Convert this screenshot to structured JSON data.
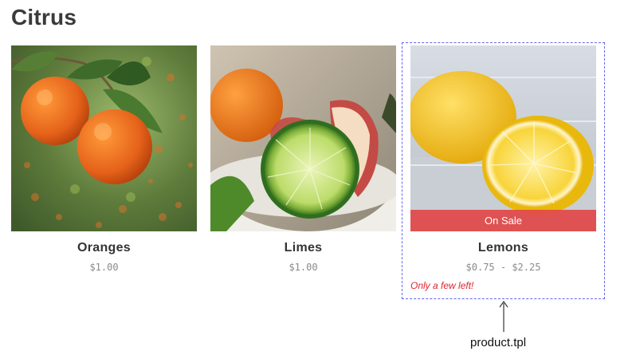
{
  "page": {
    "title": "Citrus"
  },
  "products": [
    {
      "name": "Oranges",
      "price": "$1.00"
    },
    {
      "name": "Limes",
      "price": "$1.00"
    },
    {
      "name": "Lemons",
      "price": "$0.75 - $2.25",
      "badge": "On Sale",
      "stock_note": "Only a few left!"
    }
  ],
  "annotation": {
    "label": "product.tpl"
  },
  "colors": {
    "sale": "#e14848",
    "stock_note": "#e0242b",
    "highlight_border": "#6668e8"
  }
}
